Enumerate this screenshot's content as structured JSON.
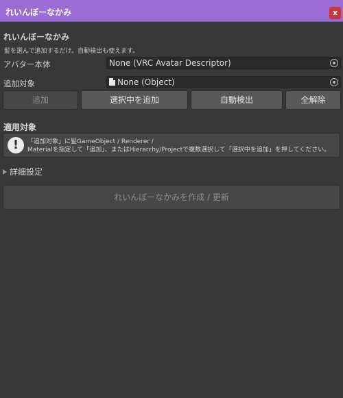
{
  "window": {
    "title": "れいんぼーなかみ",
    "close_label": "x"
  },
  "main": {
    "heading": "れいんぼーなかみ",
    "description": "髪を選んで追加するだけ。自動検出も使えます。",
    "avatar_label": "アバター本体",
    "avatar_value": "None (VRC Avatar Descriptor)",
    "target_label": "追加対象",
    "target_value": "None (Object)"
  },
  "buttons": {
    "add": "追加",
    "add_selected": "選択中を追加",
    "auto_detect": "自動検出",
    "clear_all": "全解除"
  },
  "applied": {
    "title": "適用対象",
    "help_line1": "「追加対象」に髪GameObject / Renderer /",
    "help_line2": "Materialを指定して「追加」、またはHierarchy/Projectで複数選択して「選択中を追加」を押してください。"
  },
  "advanced": {
    "label": "詳細設定"
  },
  "action": {
    "label": "れいんぼーなかみを作成 / 更新"
  }
}
